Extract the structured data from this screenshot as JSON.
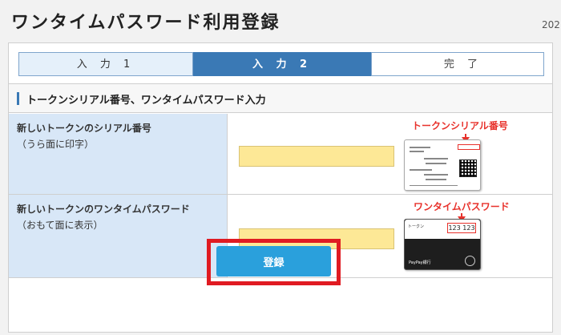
{
  "page": {
    "title": "ワンタイムパスワード利用登録",
    "date_fragment": "202"
  },
  "steps": [
    {
      "label": "入 力 1",
      "state": "done"
    },
    {
      "label": "入 力 2",
      "state": "current"
    },
    {
      "label": "完 了",
      "state": "pending"
    }
  ],
  "section": {
    "title": "トークンシリアル番号、ワンタイムパスワード入力"
  },
  "form": {
    "serial": {
      "label": "新しいトークンのシリアル番号",
      "sublabel": "（うら面に印字）",
      "value": "",
      "card_caption": "トークンシリアル番号"
    },
    "otp": {
      "label": "新しいトークンのワンタイムパスワード",
      "sublabel": "（おもて面に表示）",
      "value": "",
      "card_caption": "ワンタイムパスワード",
      "card_display": "123 123"
    }
  },
  "actions": {
    "register_label": "登録"
  },
  "colors": {
    "accent_blue": "#3a79b5",
    "button_blue": "#2aa0dc",
    "input_yellow": "#fde896",
    "label_bg": "#d8e7f7",
    "highlight_red": "#e01b22"
  }
}
